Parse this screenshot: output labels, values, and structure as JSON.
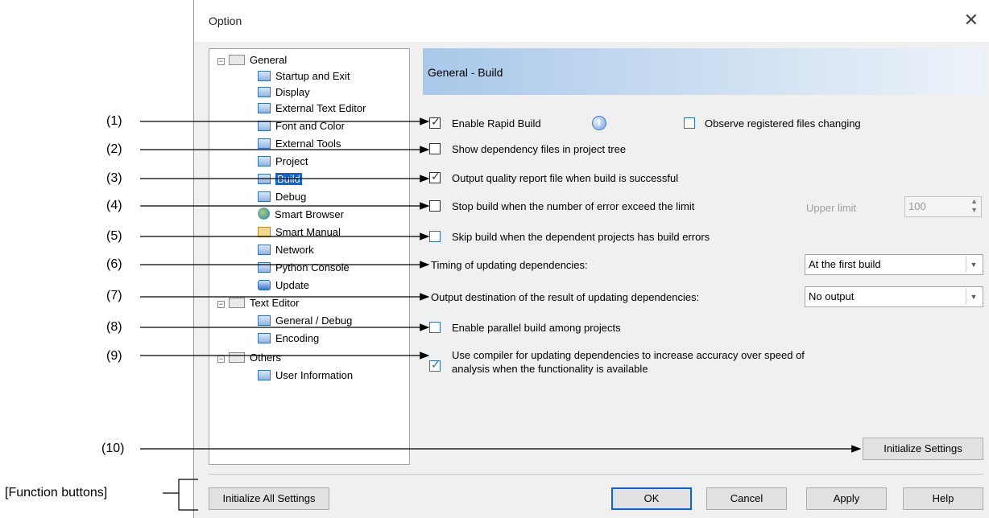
{
  "window": {
    "title": "Option",
    "close_glyph": "✕"
  },
  "tree": {
    "general": "General",
    "items": [
      "Startup and Exit",
      "Display",
      "External Text Editor",
      "Font and Color",
      "External Tools",
      "Project",
      "Build",
      "Debug",
      "Smart Browser",
      "Smart Manual",
      "Network",
      "Python Console",
      "Update"
    ],
    "text_editor": "Text Editor",
    "text_editor_items": [
      "General / Debug",
      "Encoding"
    ],
    "others": "Others",
    "others_items": [
      "User Information"
    ]
  },
  "section": {
    "title": "General - Build"
  },
  "options": {
    "rapid_build": "Enable Rapid Build",
    "observe_files": "Observe registered files changing",
    "show_dependency": "Show dependency files in project tree",
    "output_quality": "Output quality report file when build is successful",
    "stop_build": "Stop build when the number of error exceed the limit",
    "upper_limit_label": "Upper limit",
    "upper_limit_value": "100",
    "skip_build": "Skip build when the dependent projects has build errors",
    "timing_label": "Timing of updating dependencies:",
    "timing_value": "At the first build",
    "output_dest_label": "Output destination of the result of updating dependencies:",
    "output_dest_value": "No output",
    "parallel_build": "Enable parallel build among projects",
    "use_compiler_line1": "Use compiler for updating dependencies to increase accuracy over speed of",
    "use_compiler_line2": "analysis when the functionality is available",
    "initialize_settings": "Initialize Settings"
  },
  "buttons": {
    "initialize_all": "Initialize All Settings",
    "ok": "OK",
    "cancel": "Cancel",
    "apply": "Apply",
    "help": "Help"
  },
  "callouts": {
    "labels": [
      "(1)",
      "(2)",
      "(3)",
      "(4)",
      "(5)",
      "(6)",
      "(7)",
      "(8)",
      "(9)",
      "(10)"
    ],
    "function_buttons": "[Function buttons]"
  },
  "state": {
    "rapid_build_checked": true,
    "observe_files_checked": false,
    "show_dependency_checked": false,
    "output_quality_checked": true,
    "stop_build_checked": false,
    "skip_build_checked": false,
    "parallel_build_checked": false,
    "use_compiler_checked": true,
    "selected_tree_item": "Build"
  },
  "colors": {
    "selection": "#0a64d8",
    "header_gradient_start": "#a9c8ea",
    "dialog_bg": "#f0f0f0"
  }
}
